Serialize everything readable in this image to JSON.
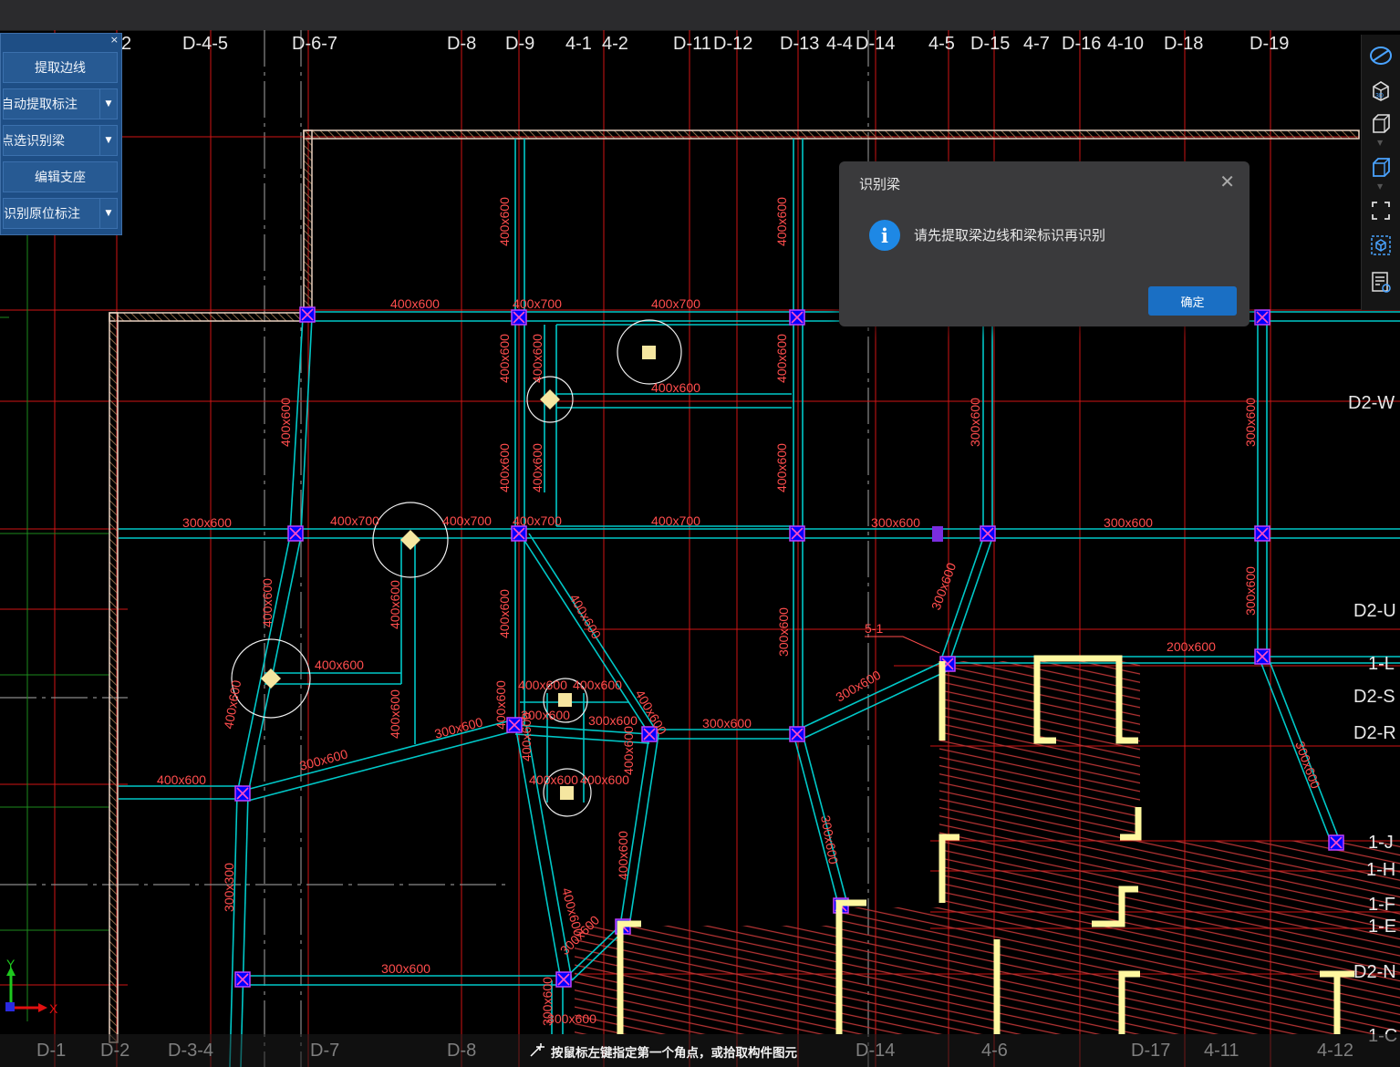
{
  "side_panel": {
    "close_glyph": "×",
    "buttons": [
      {
        "label": "提取边线",
        "has_dropdown": false
      },
      {
        "label": "自动提取标注",
        "has_dropdown": true
      },
      {
        "label": "点选识别梁",
        "has_dropdown": true
      },
      {
        "label": "编辑支座",
        "has_dropdown": false
      },
      {
        "label": "点选识别原位标注",
        "has_dropdown": true
      }
    ]
  },
  "grid_top_labels": [
    "2",
    "D-4-5",
    "D-6-7",
    "D-8",
    "D-9",
    "4-1",
    "4-2",
    "D-11",
    "D-12",
    "D-13",
    "4-4",
    "D-14",
    "4-5",
    "D-15",
    "4-7",
    "D-16",
    "4-10",
    "D-18",
    "D-19"
  ],
  "grid_right_labels": [
    "D2-W",
    "D2-U",
    "1-L",
    "D2-S",
    "D2-R",
    "1-J",
    "1-H",
    "1-F",
    "1-E",
    "D2-N",
    "1-C"
  ],
  "grid_bottom_labels": [
    "D-1",
    "D-2",
    "D-3-4",
    "D-7",
    "D-8",
    "D-14",
    "4-6",
    "D-17",
    "4-11",
    "4-12"
  ],
  "beam_labels": [
    "400x600",
    "400x700",
    "300x600",
    "200x600",
    "300x300",
    "5-1"
  ],
  "dialog": {
    "title": "识别梁",
    "message": "请先提取梁边线和梁标识再识别",
    "ok_label": "确定",
    "icon": "info-icon"
  },
  "status_prompt": "按鼠标左键指定第一个角点，或拾取构件图元",
  "axis": {
    "x": "X",
    "y": "Y"
  },
  "colors": {
    "background": "#000000",
    "beam": "#00c8c8",
    "axis_line": "#e01010",
    "beam_label": "#ff5050",
    "wall": "#f0f0f0",
    "column_fill": "#0000ff",
    "dialog_bg": "#3a3a3c",
    "ok_button": "#1a6fc4",
    "panel_bg": "#1e4e85"
  }
}
